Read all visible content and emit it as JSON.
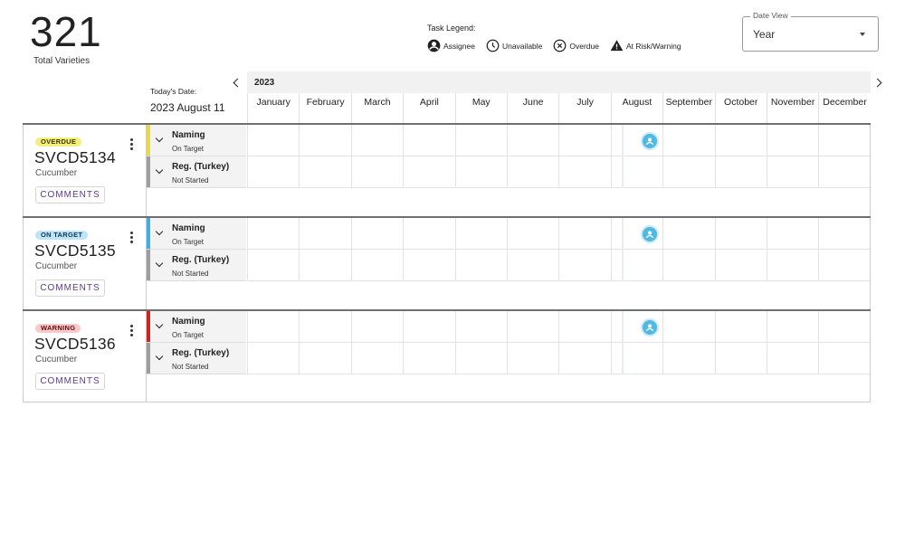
{
  "summary": {
    "count": "321",
    "label": "Total Varieties"
  },
  "legend": {
    "title": "Task Legend:",
    "items": [
      {
        "icon": "account-circle-icon",
        "label": "Assignee"
      },
      {
        "icon": "clock-icon",
        "label": "Unavailable"
      },
      {
        "icon": "x-circle-icon",
        "label": "Overdue"
      },
      {
        "icon": "warning-triangle-icon",
        "label": "At Risk/Warning"
      }
    ]
  },
  "date_view": {
    "label": "Date View",
    "value": "Year"
  },
  "today": {
    "label": "Today's Date:",
    "value": "2023 August 11"
  },
  "timeline": {
    "year": "2023",
    "months": [
      "January",
      "February",
      "March",
      "April",
      "May",
      "June",
      "July",
      "August",
      "September",
      "October",
      "November",
      "December"
    ]
  },
  "varieties": [
    {
      "badge": "OVERDUE",
      "badge_bg": "#f4ee7c",
      "badge_fg": "#3b3a00",
      "code": "SVCD5134",
      "crop": "Cucumber",
      "comments_label": "COMMENTS",
      "tasks": [
        {
          "name": "Naming",
          "status": "On Target",
          "color": "#e9d94a"
        },
        {
          "name": "Reg. (Turkey)",
          "status": "Not Started",
          "color": "#9e9e9e"
        }
      ]
    },
    {
      "badge": "ON TARGET",
      "badge_bg": "#bfe3f7",
      "badge_fg": "#0d3a56",
      "code": "SVCD5135",
      "crop": "Cucumber",
      "comments_label": "COMMENTS",
      "tasks": [
        {
          "name": "Naming",
          "status": "On Target",
          "color": "#41aee3"
        },
        {
          "name": "Reg. (Turkey)",
          "status": "Not Started",
          "color": "#9e9e9e"
        }
      ]
    },
    {
      "badge": "WARNING",
      "badge_bg": "#f9c9c9",
      "badge_fg": "#5a0d0d",
      "code": "SVCD5136",
      "crop": "Cucumber",
      "comments_label": "COMMENTS",
      "tasks": [
        {
          "name": "Naming",
          "status": "On Target",
          "color": "#c62828"
        },
        {
          "name": "Reg. (Turkey)",
          "status": "Not Started",
          "color": "#9e9e9e"
        }
      ]
    }
  ]
}
